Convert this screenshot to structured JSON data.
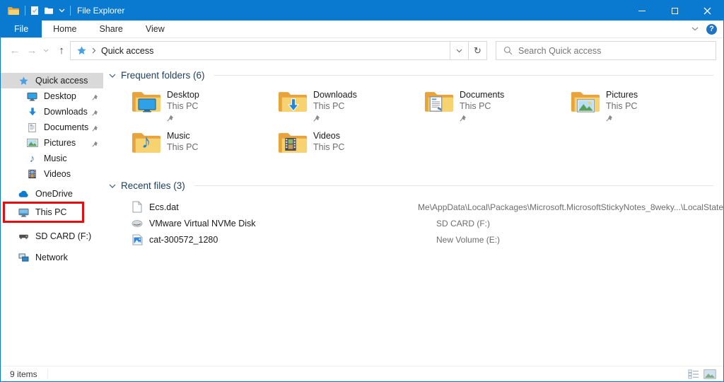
{
  "titlebar": {
    "title": "File Explorer"
  },
  "ribbon": {
    "tabs": [
      {
        "label": "File"
      },
      {
        "label": "Home"
      },
      {
        "label": "Share"
      },
      {
        "label": "View"
      }
    ],
    "help_glyph": "?"
  },
  "navbar": {
    "back_glyph": "←",
    "forward_glyph": "→",
    "up_glyph": "↑",
    "refresh_glyph": "↻",
    "breadcrumb_root": "Quick access",
    "search_placeholder": "Search Quick access"
  },
  "sidebar": {
    "items": [
      {
        "label": "Quick access"
      },
      {
        "label": "Desktop"
      },
      {
        "label": "Downloads"
      },
      {
        "label": "Documents"
      },
      {
        "label": "Pictures"
      },
      {
        "label": "Music"
      },
      {
        "label": "Videos"
      },
      {
        "label": "OneDrive"
      },
      {
        "label": "This PC"
      },
      {
        "label": "SD CARD (F:)"
      },
      {
        "label": "Network"
      }
    ]
  },
  "frequent": {
    "header": "Frequent folders (6)",
    "folders": [
      {
        "name": "Desktop",
        "location": "This PC"
      },
      {
        "name": "Downloads",
        "location": "This PC"
      },
      {
        "name": "Documents",
        "location": "This PC"
      },
      {
        "name": "Pictures",
        "location": "This PC"
      },
      {
        "name": "Music",
        "location": "This PC"
      },
      {
        "name": "Videos",
        "location": "This PC"
      }
    ]
  },
  "recent": {
    "header": "Recent files (3)",
    "files": [
      {
        "name": "Ecs.dat",
        "path": "Me\\AppData\\Local\\Packages\\Microsoft.MicrosoftStickyNotes_8weky...\\LocalState"
      },
      {
        "name": "VMware Virtual NVMe Disk",
        "path": "SD CARD (F:)"
      },
      {
        "name": "cat-300572_1280",
        "path": "New Volume (E:)"
      }
    ]
  },
  "statusbar": {
    "items_count": "9 items"
  },
  "icons": {
    "music_note": "♪"
  },
  "colors": {
    "accent": "#0a7ad1",
    "annotation_red": "#e30e0e",
    "folder_front": "#f7d271",
    "folder_back": "#e7a33c"
  }
}
